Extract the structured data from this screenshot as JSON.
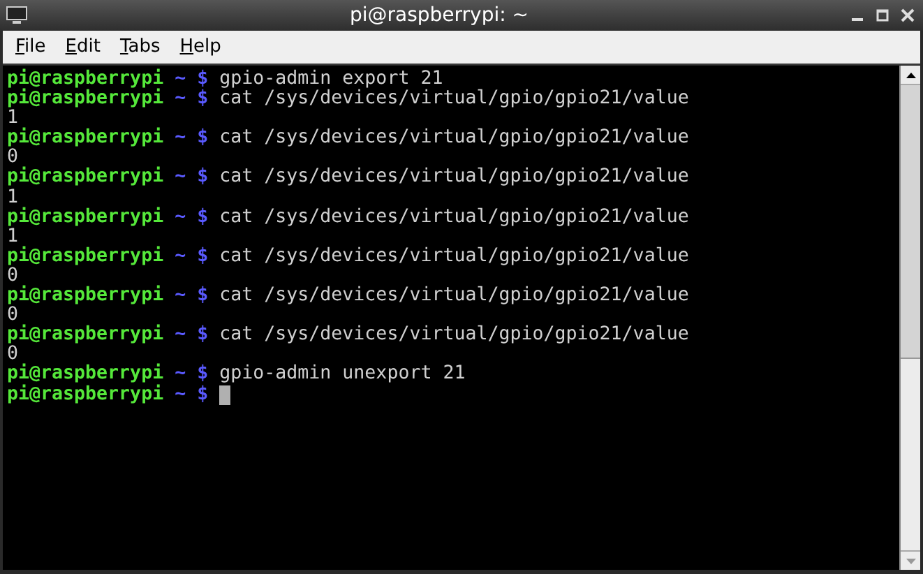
{
  "window": {
    "title": "pi@raspberrypi: ~"
  },
  "menu": [
    "File",
    "Edit",
    "Tabs",
    "Help"
  ],
  "terminal": {
    "lines": [
      {
        "kind": "prompt",
        "user": "pi@raspberrypi",
        "path": "~",
        "symbol": "$",
        "command": "gpio-admin export 21"
      },
      {
        "kind": "prompt",
        "user": "pi@raspberrypi",
        "path": "~",
        "symbol": "$",
        "command": "cat /sys/devices/virtual/gpio/gpio21/value"
      },
      {
        "kind": "output",
        "text": "1"
      },
      {
        "kind": "prompt",
        "user": "pi@raspberrypi",
        "path": "~",
        "symbol": "$",
        "command": "cat /sys/devices/virtual/gpio/gpio21/value"
      },
      {
        "kind": "output",
        "text": "0"
      },
      {
        "kind": "prompt",
        "user": "pi@raspberrypi",
        "path": "~",
        "symbol": "$",
        "command": "cat /sys/devices/virtual/gpio/gpio21/value"
      },
      {
        "kind": "output",
        "text": "1"
      },
      {
        "kind": "prompt",
        "user": "pi@raspberrypi",
        "path": "~",
        "symbol": "$",
        "command": "cat /sys/devices/virtual/gpio/gpio21/value"
      },
      {
        "kind": "output",
        "text": "1"
      },
      {
        "kind": "prompt",
        "user": "pi@raspberrypi",
        "path": "~",
        "symbol": "$",
        "command": "cat /sys/devices/virtual/gpio/gpio21/value"
      },
      {
        "kind": "output",
        "text": "0"
      },
      {
        "kind": "prompt",
        "user": "pi@raspberrypi",
        "path": "~",
        "symbol": "$",
        "command": "cat /sys/devices/virtual/gpio/gpio21/value"
      },
      {
        "kind": "output",
        "text": "0"
      },
      {
        "kind": "prompt",
        "user": "pi@raspberrypi",
        "path": "~",
        "symbol": "$",
        "command": "cat /sys/devices/virtual/gpio/gpio21/value"
      },
      {
        "kind": "output",
        "text": "0"
      },
      {
        "kind": "prompt",
        "user": "pi@raspberrypi",
        "path": "~",
        "symbol": "$",
        "command": "gpio-admin unexport 21"
      },
      {
        "kind": "prompt",
        "user": "pi@raspberrypi",
        "path": "~",
        "symbol": "$",
        "cursor": true
      }
    ]
  }
}
